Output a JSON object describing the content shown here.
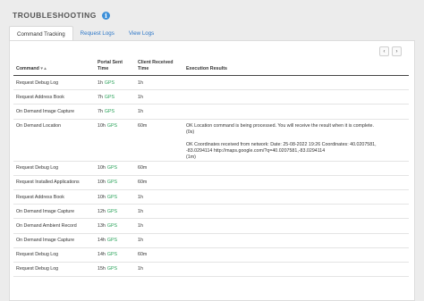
{
  "page": {
    "title": "TROUBLESHOOTING",
    "info_icon": "info-icon"
  },
  "tabs": [
    {
      "label": "Command Tracking",
      "active": true
    },
    {
      "label": "Request Logs",
      "active": false
    },
    {
      "label": "View Logs",
      "active": false
    }
  ],
  "pager": {
    "prev": "‹",
    "next": "›"
  },
  "table": {
    "headers": {
      "command": "Command",
      "command_sort": "▾ ▴",
      "portal_sent": "Portal Sent Time",
      "client_received": "Client Received Time",
      "execution": "Execution Results"
    },
    "rows": [
      {
        "command": "Request Debug Log",
        "portal": "1h",
        "gps": "GPS",
        "client": "1h",
        "result": []
      },
      {
        "command": "Request Address Book",
        "portal": "7h",
        "gps": "GPS",
        "client": "1h",
        "result": []
      },
      {
        "command": "On Demand Image Capture",
        "portal": "7h",
        "gps": "GPS",
        "client": "1h",
        "result": []
      },
      {
        "command": "On Demand Location",
        "portal": "10h",
        "gps": "GPS",
        "client": "60m",
        "result": [
          "OK Location command is being processed. You will receive the result when it is complete.",
          "(0s)",
          "",
          "OK Coordinates received from network: Date: 25-08-2022 19:26 Coordinates: 40.0207581,",
          "-83.0294114 http://maps.google.com/?q=40.0207581,-83.0294114",
          "(1m)"
        ]
      },
      {
        "command": "Request Debug Log",
        "portal": "10h",
        "gps": "GPS",
        "client": "60m",
        "result": []
      },
      {
        "command": "Request Installed Applications",
        "portal": "10h",
        "gps": "GPS",
        "client": "60m",
        "result": []
      },
      {
        "command": "Request Address Book",
        "portal": "10h",
        "gps": "GPS",
        "client": "1h",
        "result": []
      },
      {
        "command": "On Demand Image Capture",
        "portal": "12h",
        "gps": "GPS",
        "client": "1h",
        "result": []
      },
      {
        "command": "On Demand Ambient Record",
        "portal": "13h",
        "gps": "GPS",
        "client": "1h",
        "result": []
      },
      {
        "command": "On Demand Image Capture",
        "portal": "14h",
        "gps": "GPS",
        "client": "1h",
        "result": []
      },
      {
        "command": "Request Debug Log",
        "portal": "14h",
        "gps": "GPS",
        "client": "60m",
        "result": []
      },
      {
        "command": "Request Debug Log",
        "portal": "15h",
        "gps": "GPS",
        "client": "1h",
        "result": []
      }
    ]
  }
}
